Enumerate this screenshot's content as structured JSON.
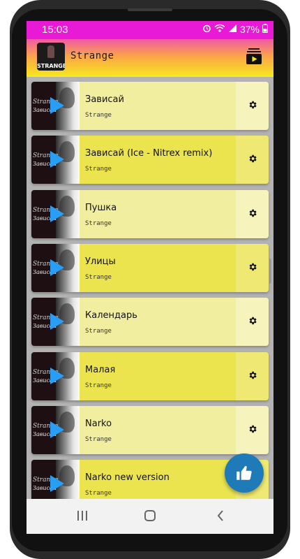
{
  "status_bar": {
    "time": "15:03",
    "battery": "37%"
  },
  "app_bar": {
    "logo_text": "STRANGE",
    "title": "Strange"
  },
  "tracks": [
    {
      "title": "Зависай",
      "artist": "Strange",
      "thumb_line1": "Strange",
      "thumb_line2": "Зависай"
    },
    {
      "title": "Зависай (Ice - Nitrex remix)",
      "artist": "Strange",
      "thumb_line1": "Strange",
      "thumb_line2": "Зависай"
    },
    {
      "title": "Пушка",
      "artist": "Strange",
      "thumb_line1": "Strange",
      "thumb_line2": "Зависай"
    },
    {
      "title": "Улицы",
      "artist": "Strange",
      "thumb_line1": "Strange",
      "thumb_line2": "Зависай"
    },
    {
      "title": "Календарь",
      "artist": "Strange",
      "thumb_line1": "Strange",
      "thumb_line2": "Зависай"
    },
    {
      "title": "Малая",
      "artist": "Strange",
      "thumb_line1": "Strange",
      "thumb_line2": "Зависай"
    },
    {
      "title": "Narko",
      "artist": "Strange",
      "thumb_line1": "Strange",
      "thumb_line2": "Зависай"
    },
    {
      "title": "Narko new version",
      "artist": "Strange",
      "thumb_line1": "Strange",
      "thumb_line2": "Зависай"
    }
  ],
  "colors": {
    "status_bar": "#e81ad6",
    "card_light": "#f2ee9f",
    "card_light_opt": "#f7f3bd",
    "card_dark": "#ebe44f",
    "card_dark_opt": "#efe973",
    "play_icon": "#2a9df4",
    "fab": "#1f7ab8"
  },
  "icons": {
    "playlist": "playlist-play-icon",
    "settings": "gear-icon",
    "fab": "thumbs-up-icon",
    "nav_recents": "recents-icon",
    "nav_home": "home-icon",
    "nav_back": "back-icon"
  }
}
